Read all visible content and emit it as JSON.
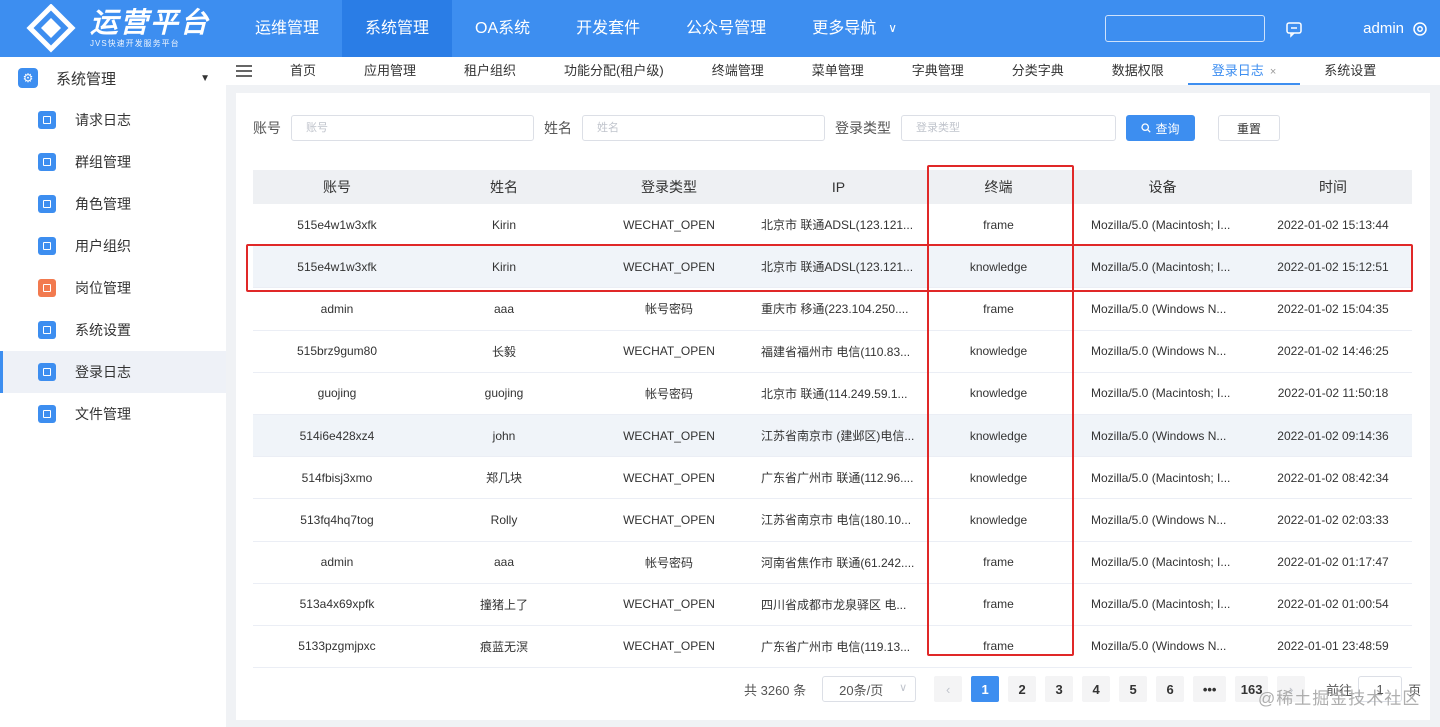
{
  "brand": {
    "title": "运营平台",
    "subtitle": "JVS快速开发服务平台"
  },
  "topnav": {
    "items": [
      "运维管理",
      "系统管理",
      "OA系统",
      "开发套件",
      "公众号管理",
      "更多导航"
    ],
    "active_index": 1,
    "user": "admin"
  },
  "sidebar": {
    "section": "系统管理",
    "items": [
      {
        "label": "请求日志",
        "color": "#3d8ef0"
      },
      {
        "label": "群组管理",
        "color": "#3d8ef0"
      },
      {
        "label": "角色管理",
        "color": "#3d8ef0"
      },
      {
        "label": "用户组织",
        "color": "#3d8ef0"
      },
      {
        "label": "岗位管理",
        "color": "#f27a4f"
      },
      {
        "label": "系统设置",
        "color": "#3d8ef0"
      },
      {
        "label": "登录日志",
        "color": "#3d8ef0"
      },
      {
        "label": "文件管理",
        "color": "#3d8ef0"
      }
    ],
    "active_index": 6
  },
  "tabs": {
    "items": [
      "首页",
      "应用管理",
      "租户组织",
      "功能分配(租户级)",
      "终端管理",
      "菜单管理",
      "字典管理",
      "分类字典",
      "数据权限",
      "登录日志",
      "系统设置"
    ],
    "active_index": 9,
    "close_glyph": "×"
  },
  "filters": {
    "account_label": "账号",
    "account_placeholder": "账号",
    "name_label": "姓名",
    "name_placeholder": "姓名",
    "type_label": "登录类型",
    "type_placeholder": "登录类型",
    "query_button": "查询",
    "reset_button": "重置"
  },
  "table": {
    "columns": [
      "账号",
      "姓名",
      "登录类型",
      "IP",
      "终端",
      "设备",
      "时间"
    ],
    "rows": [
      [
        "515e4w1w3xfk",
        "Kirin",
        "WECHAT_OPEN",
        "北京市 联通ADSL(123.121...",
        "frame",
        "Mozilla/5.0 (Macintosh; I...",
        "2022-01-02 15:13:44"
      ],
      [
        "515e4w1w3xfk",
        "Kirin",
        "WECHAT_OPEN",
        "北京市 联通ADSL(123.121...",
        "knowledge",
        "Mozilla/5.0 (Macintosh; I...",
        "2022-01-02 15:12:51"
      ],
      [
        "admin",
        "aaa",
        "帐号密码",
        "重庆市 移通(223.104.250....",
        "frame",
        "Mozilla/5.0 (Windows N...",
        "2022-01-02 15:04:35"
      ],
      [
        "515brz9gum80",
        "长毅",
        "WECHAT_OPEN",
        "福建省福州市 电信(110.83...",
        "knowledge",
        "Mozilla/5.0 (Windows N...",
        "2022-01-02 14:46:25"
      ],
      [
        "guojing",
        "guojing",
        "帐号密码",
        "北京市 联通(114.249.59.1...",
        "knowledge",
        "Mozilla/5.0 (Macintosh; I...",
        "2022-01-02 11:50:18"
      ],
      [
        "514i6e428xz4",
        "john",
        "WECHAT_OPEN",
        "江苏省南京市 (建邺区)电信...",
        "knowledge",
        "Mozilla/5.0 (Windows N...",
        "2022-01-02 09:14:36"
      ],
      [
        "514fbisj3xmo",
        "郑几块",
        "WECHAT_OPEN",
        "广东省广州市 联通(112.96....",
        "knowledge",
        "Mozilla/5.0 (Macintosh; I...",
        "2022-01-02 08:42:34"
      ],
      [
        "513fq4hq7tog",
        "Rolly",
        "WECHAT_OPEN",
        "江苏省南京市 电信(180.10...",
        "knowledge",
        "Mozilla/5.0 (Windows N...",
        "2022-01-02 02:03:33"
      ],
      [
        "admin",
        "aaa",
        "帐号密码",
        "河南省焦作市 联通(61.242....",
        "frame",
        "Mozilla/5.0 (Macintosh; I...",
        "2022-01-02 01:17:47"
      ],
      [
        "513a4x69xpfk",
        "撞猪上了",
        "WECHAT_OPEN",
        "四川省成都市龙泉驿区 电...",
        "frame",
        "Mozilla/5.0 (Macintosh; I...",
        "2022-01-02 01:00:54"
      ],
      [
        "5133pzgmjpxc",
        "痕蓝无溟",
        "WECHAT_OPEN",
        "广东省广州市 电信(119.13...",
        "frame",
        "Mozilla/5.0 (Windows N...",
        "2022-01-01 23:48:59"
      ]
    ],
    "alt_rows": [
      1,
      5
    ]
  },
  "pagination": {
    "total": "共 3260 条",
    "page_size": "20条/页",
    "pages": [
      "1",
      "2",
      "3",
      "4",
      "5",
      "6",
      "•••",
      "163"
    ],
    "active_page": "1",
    "goto_prefix": "前往",
    "goto_value": "1",
    "goto_suffix": "页"
  },
  "watermark": "@稀土掘金技术社区",
  "colors": {
    "primary": "#3d8ef0",
    "highlight": "#e02828",
    "warn_icon": "#f27a4f"
  }
}
